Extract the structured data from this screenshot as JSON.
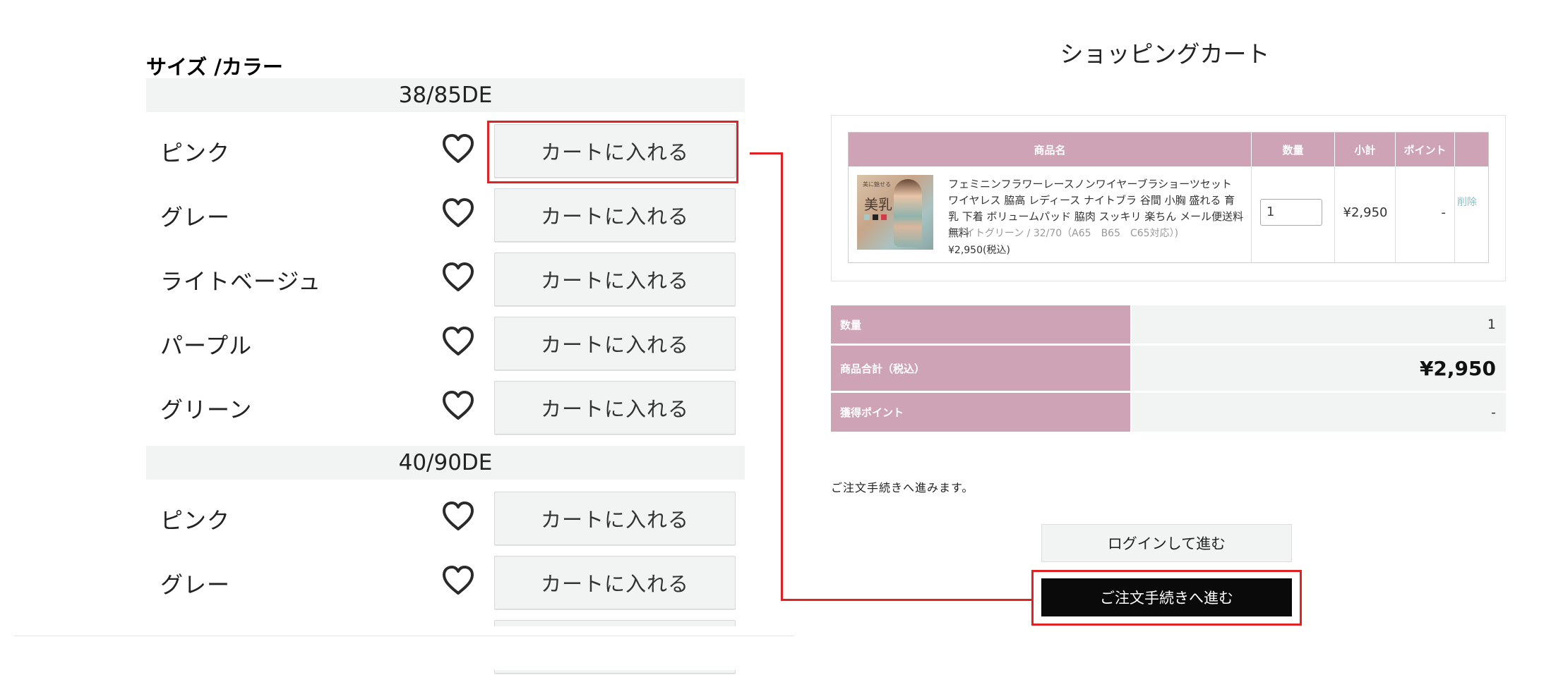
{
  "left_panel": {
    "section_title": "サイズ /カラー",
    "sizes": [
      {
        "label": "38/85DE",
        "colors": [
          "ピンク",
          "グレー",
          "ライトベージュ",
          "パープル",
          "グリーン"
        ]
      },
      {
        "label": "40/90DE",
        "colors": [
          "ピンク",
          "グレー"
        ]
      }
    ],
    "add_to_cart_label": "カートに入れる",
    "favorite_icon": "heart-icon"
  },
  "cart": {
    "title": "ショッピングカート",
    "table_headers": {
      "product": "商品名",
      "quantity": "数量",
      "subtotal": "小計",
      "points": "ポイント"
    },
    "item": {
      "thumb_text": "美乳",
      "thumb_small_text": "美に魅せる",
      "name": "フェミニンフラワーレースノンワイヤーブラショーツセット ワイヤレス 脇高 レディース ナイトブラ 谷間 小胸 盛れる 育乳 下着 ボリュームパッド 脇肉 スッキリ 楽ちん メール便送料無料",
      "variant": "( ライトグリーン / 32/70（A65　B65　C65対応）)",
      "price": "¥2,950(税込)",
      "quantity": "1",
      "subtotal": "¥2,950",
      "points": "-",
      "delete_label": "削除"
    },
    "summary": {
      "quantity_label": "数量",
      "quantity_value": "1",
      "total_label": "商品合計（税込）",
      "total_value": "¥2,950",
      "points_label": "獲得ポイント",
      "points_value": "-"
    },
    "proceed_note": "ご注文手続きへ進みます。",
    "login_button": "ログインして進む",
    "checkout_button": "ご注文手続きへ進む"
  },
  "colors": {
    "accent_pink": "#cfa3b6",
    "highlight_red": "#e02222",
    "button_gray": "#f2f3f3",
    "checkout_black": "#0a0a0a"
  }
}
